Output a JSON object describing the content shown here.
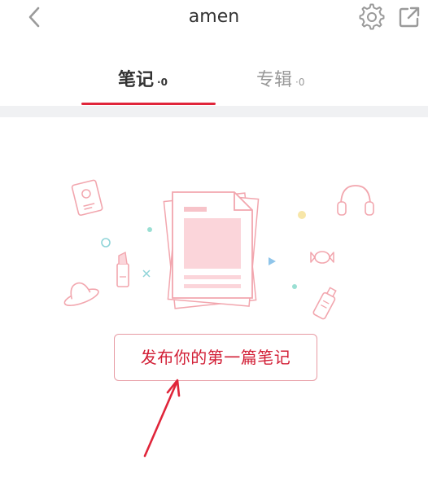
{
  "header": {
    "title": "amen",
    "back_icon": "chevron-left-icon",
    "settings_icon": "gear-icon",
    "share_icon": "external-link-icon"
  },
  "tabs": [
    {
      "label": "笔记",
      "count": "·0",
      "active": true
    },
    {
      "label": "专辑",
      "count": "·0",
      "active": false
    }
  ],
  "empty_state": {
    "cta_label": "发布你的第一篇笔记"
  },
  "colors": {
    "accent": "#e0253a",
    "illustration_pink": "#f2a6ae",
    "tab_inactive": "#999999",
    "text_primary": "#333333"
  }
}
